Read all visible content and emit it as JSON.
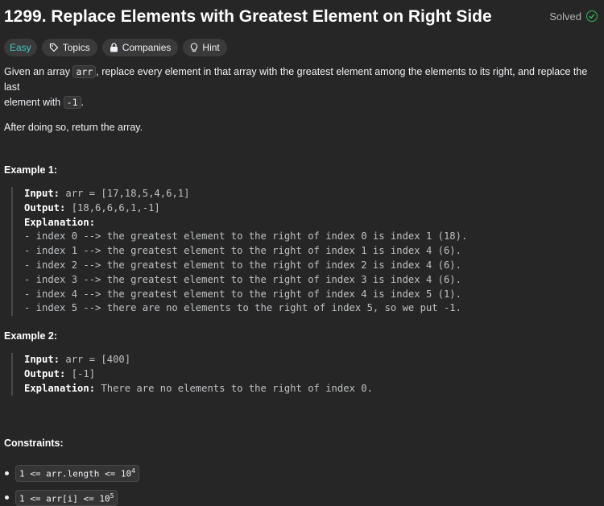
{
  "problem": {
    "title": "1299. Replace Elements with Greatest Element on Right Side",
    "status": "Solved"
  },
  "tags": {
    "difficulty": "Easy",
    "topics": "Topics",
    "companies": "Companies",
    "hint": "Hint"
  },
  "description": {
    "line1_a": "Given an array ",
    "line1_code": "arr",
    "line1_b": ", replace every element in that array with the greatest element among the elements to its right, and replace the last",
    "line2_a": "element with ",
    "line2_code": "-1",
    "line2_b": ".",
    "para2": "After doing so, return the array."
  },
  "example1": {
    "heading": "Example 1:",
    "input_label": "Input:",
    "input_value": " arr = [17,18,5,4,6,1]",
    "output_label": "Output:",
    "output_value": " [18,6,6,6,1,-1]",
    "explanation_label": "Explanation:",
    "lines": [
      "- index 0 --> the greatest element to the right of index 0 is index 1 (18).",
      "- index 1 --> the greatest element to the right of index 1 is index 4 (6).",
      "- index 2 --> the greatest element to the right of index 2 is index 4 (6).",
      "- index 3 --> the greatest element to the right of index 3 is index 4 (6).",
      "- index 4 --> the greatest element to the right of index 4 is index 5 (1).",
      "- index 5 --> there are no elements to the right of index 5, so we put -1."
    ]
  },
  "example2": {
    "heading": "Example 2:",
    "input_label": "Input:",
    "input_value": " arr = [400]",
    "output_label": "Output:",
    "output_value": " [-1]",
    "explanation_label": "Explanation:",
    "explanation_value": " There are no elements to the right of index 0."
  },
  "constraints": {
    "heading": "Constraints:",
    "items": [
      {
        "text": "1 <= arr.length <= 10",
        "sup": "4"
      },
      {
        "text": "1 <= arr[i] <= 10",
        "sup": "5"
      }
    ]
  },
  "colors": {
    "background": "#262626",
    "easy": "#46c6c2",
    "solved_check": "#2cbb5d"
  },
  "icons": [
    "check-circle-icon",
    "tag-icon",
    "lock-icon",
    "lightbulb-icon"
  ]
}
